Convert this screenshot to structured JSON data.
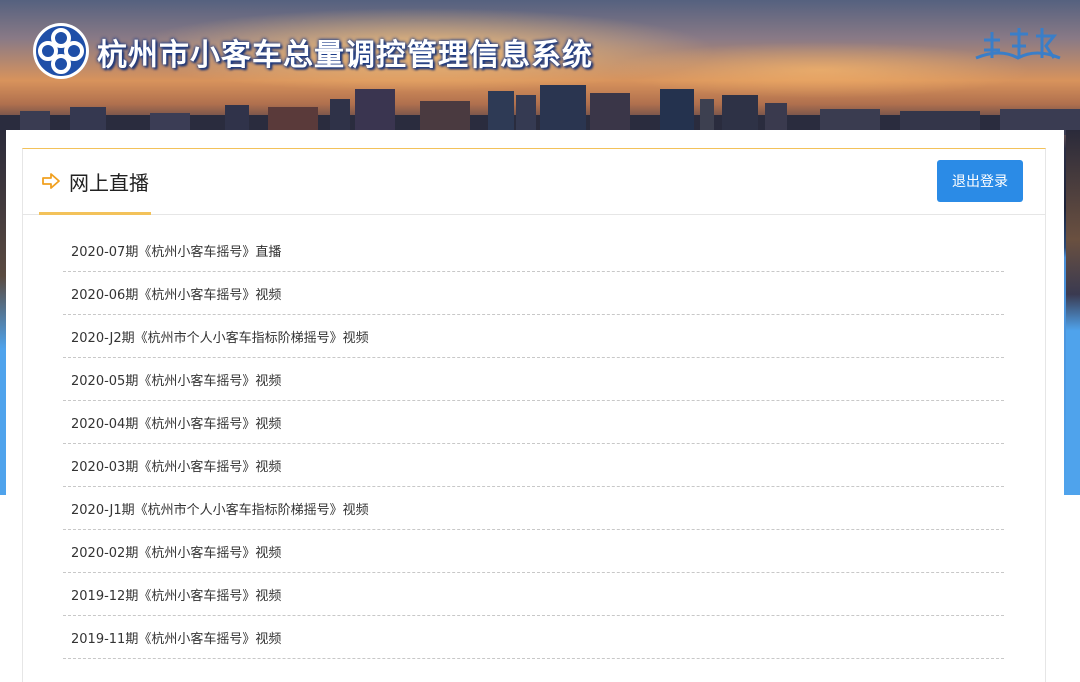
{
  "header": {
    "site_title": "杭州市小客车总量调控管理信息系统"
  },
  "panel": {
    "title": "网上直播",
    "logout_label": "退出登录"
  },
  "list": [
    {
      "label": "2020-07期《杭州小客车摇号》直播"
    },
    {
      "label": "2020-06期《杭州小客车摇号》视频"
    },
    {
      "label": "2020-J2期《杭州市个人小客车指标阶梯摇号》视频"
    },
    {
      "label": "2020-05期《杭州小客车摇号》视频"
    },
    {
      "label": "2020-04期《杭州小客车摇号》视频"
    },
    {
      "label": "2020-03期《杭州小客车摇号》视频"
    },
    {
      "label": "2020-J1期《杭州市个人小客车指标阶梯摇号》视频"
    },
    {
      "label": "2020-02期《杭州小客车摇号》视频"
    },
    {
      "label": "2019-12期《杭州小客车摇号》视频"
    },
    {
      "label": "2019-11期《杭州小客车摇号》视频"
    }
  ],
  "colors": {
    "accent": "#f3c25a",
    "button": "#2b8be6",
    "banner_blue": "#4fa3ec"
  }
}
